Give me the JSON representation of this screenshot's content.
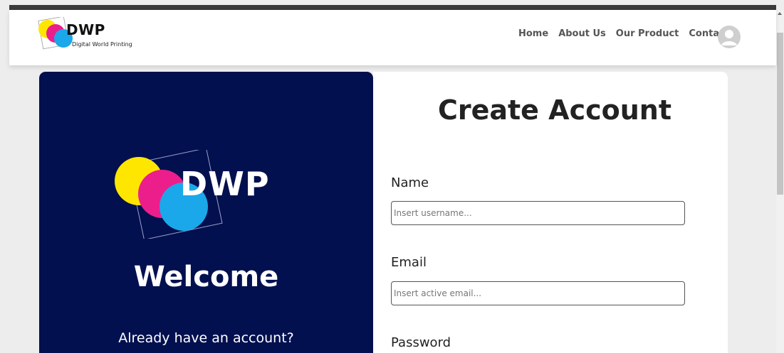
{
  "navbar": {
    "brand_title": "DWP",
    "brand_subtitle": "Digital World Printing",
    "links": [
      "Home",
      "About Us",
      "Our Product",
      "Contact"
    ]
  },
  "left_panel": {
    "logo_text": "DWP",
    "welcome": "Welcome",
    "login_prompt": "Already have an account?"
  },
  "form": {
    "title": "Create Account",
    "fields": {
      "name": {
        "label": "Name",
        "placeholder": "Insert username..."
      },
      "email": {
        "label": "Email",
        "placeholder": "Insert active email..."
      },
      "password": {
        "label": "Password"
      }
    }
  },
  "colors": {
    "panel_bg": "#03104f",
    "logo_yellow": "#ffe600",
    "logo_magenta": "#ec1e8c",
    "logo_cyan": "#1aa8ea"
  },
  "icons": [
    "user-avatar-icon"
  ]
}
